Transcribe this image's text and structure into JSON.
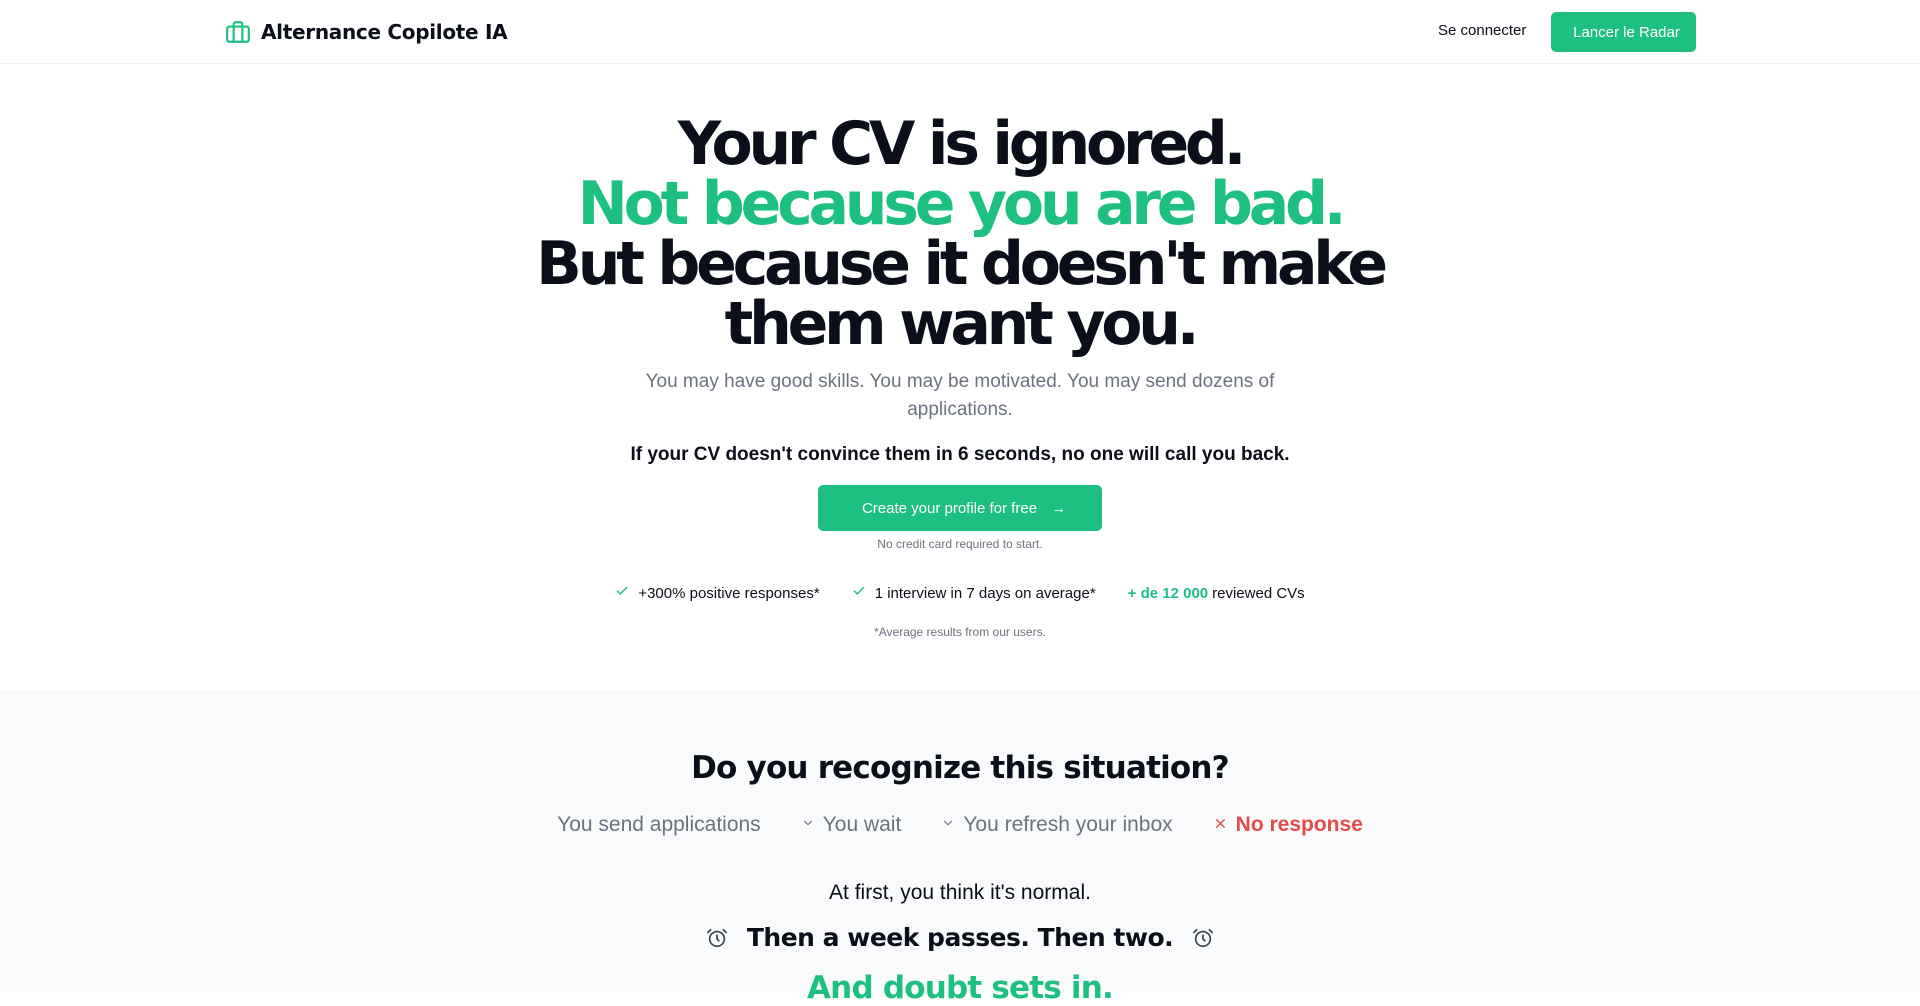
{
  "header": {
    "brand_name": "Alternance Copilote IA",
    "brand_icon": "briefcase-icon",
    "login_label": "Se connecter",
    "cta_label": "Lancer le Radar",
    "cta_icon": ""
  },
  "hero": {
    "title_line1": "Your CV is ignored.",
    "title_line2": "Not because you are bad.",
    "title_line3": "But because it doesn't make",
    "title_line4": "them want you.",
    "subtitle": "You may have good skills. You may be motivated. You may send dozens of applications.",
    "strong_line": "If your CV doesn't convince them in 6 seconds, no one will call you back.",
    "cta_label": "Create your profile for free",
    "cta_icon": "",
    "cta_arrow": "→",
    "note": "No credit card required to start.",
    "stats": [
      {
        "icon": "check-icon",
        "text": "+300% positive responses*"
      },
      {
        "icon": "check-icon",
        "text": "1 interview in 7 days on average*"
      },
      {
        "highlight": "+ de 12 000",
        "text": "reviewed CVs"
      }
    ],
    "footnote": "*Average results from our users."
  },
  "situation": {
    "title": "Do you recognize this situation?",
    "steps": [
      {
        "label": "You send applications",
        "icon": ""
      },
      {
        "label": "You wait",
        "icon": "chevron-down-icon"
      },
      {
        "label": "You refresh your inbox",
        "icon": "chevron-down-icon"
      },
      {
        "label": "No response",
        "icon": "close-icon"
      }
    ],
    "normal_line": "At first, you think it's normal.",
    "week_line": "Then a week passes. Then two.",
    "doubt_line": "And doubt sets in."
  },
  "colors": {
    "accent": "#1ec081",
    "danger": "#e44c4c",
    "text": "#0b0f19",
    "muted": "#6b7280",
    "section_bg": "#f9fafb"
  }
}
